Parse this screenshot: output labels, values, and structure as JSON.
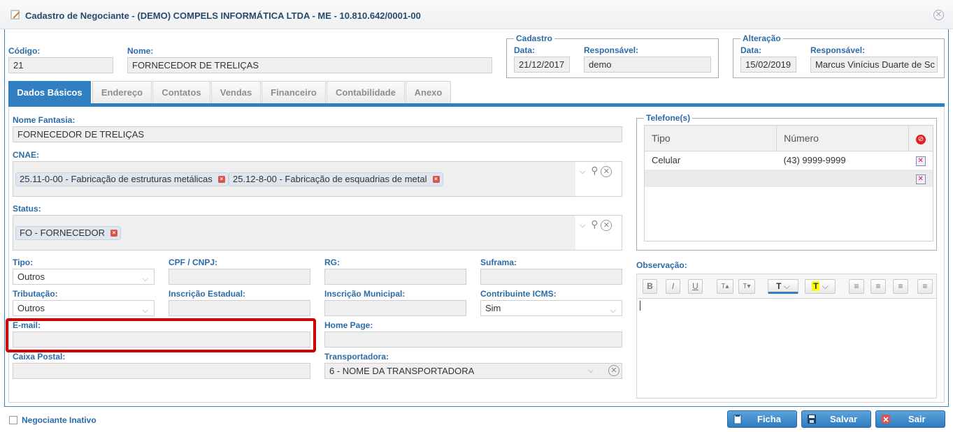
{
  "window": {
    "title": "Cadastro de Negociante - (DEMO) COMPELS INFORMÁTICA LTDA - ME - 10.810.642/0001-00"
  },
  "header": {
    "codigo_label": "Código:",
    "codigo_value": "21",
    "nome_label": "Nome:",
    "nome_value": "FORNECEDOR DE TRELIÇAS",
    "cadastro": {
      "legend": "Cadastro",
      "data_label": "Data:",
      "data_value": "21/12/2017",
      "resp_label": "Responsável:",
      "resp_value": "demo"
    },
    "alteracao": {
      "legend": "Alteração",
      "data_label": "Data:",
      "data_value": "15/02/2019",
      "resp_label": "Responsável:",
      "resp_value": "Marcus Vinícius Duarte de Sc"
    }
  },
  "tabs": [
    {
      "label": "Dados Básicos",
      "active": true
    },
    {
      "label": "Endereço"
    },
    {
      "label": "Contatos"
    },
    {
      "label": "Vendas"
    },
    {
      "label": "Financeiro"
    },
    {
      "label": "Contabilidade"
    },
    {
      "label": "Anexo"
    }
  ],
  "form": {
    "nome_fantasia_label": "Nome Fantasia:",
    "nome_fantasia_value": "FORNECEDOR DE TRELIÇAS",
    "cnae_label": "CNAE:",
    "cnae_chips": [
      "25.11-0-00 - Fabricação de estruturas metálicas",
      "25.12-8-00 - Fabricação de esquadrias de metal"
    ],
    "status_label": "Status:",
    "status_chips": [
      "FO - FORNECEDOR"
    ],
    "tipo_label": "Tipo:",
    "tipo_value": "Outros",
    "cpf_label": "CPF / CNPJ:",
    "cpf_value": "",
    "rg_label": "RG:",
    "rg_value": "",
    "suframa_label": "Suframa:",
    "suframa_value": "",
    "tributacao_label": "Tributação:",
    "tributacao_value": "Outros",
    "ie_label": "Inscrição Estadual:",
    "ie_value": "",
    "im_label": "Inscrição Municipal:",
    "im_value": "",
    "icms_label": "Contribuinte ICMS:",
    "icms_value": "Sim",
    "email_label": "E-mail:",
    "email_value": "",
    "homepage_label": "Home Page:",
    "homepage_value": "",
    "caixa_label": "Caixa Postal:",
    "caixa_value": "",
    "transportadora_label": "Transportadora:",
    "transportadora_value": "6 - NOME DA TRANSPORTADORA"
  },
  "phones": {
    "legend": "Telefone(s)",
    "col_tipo": "Tipo",
    "col_numero": "Número",
    "rows": [
      {
        "tipo": "Celular",
        "numero": "(43) 9999-9999"
      }
    ]
  },
  "observacao": {
    "label": "Observação:",
    "toolbar": [
      "B",
      "I",
      "U",
      "T▴",
      "T▾",
      "T",
      "T",
      "≡",
      "≡",
      "≡",
      "≡"
    ]
  },
  "footer": {
    "inativo_label": "Negociante Inativo",
    "ficha_label": "Ficha",
    "salvar_label": "Salvar",
    "sair_label": "Sair"
  },
  "colors": {
    "accent": "#2f7fc1",
    "label": "#2a6ba8",
    "highlight": "#cc0000"
  }
}
